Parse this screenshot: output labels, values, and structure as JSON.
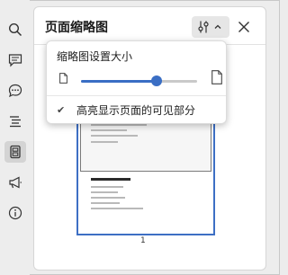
{
  "sidebar": {
    "items": [
      {
        "icon": "search-icon",
        "active": false
      },
      {
        "icon": "comment-icon",
        "active": false
      },
      {
        "icon": "chat-bubbles-icon",
        "active": false
      },
      {
        "icon": "outline-list-icon",
        "active": false
      },
      {
        "icon": "thumbnails-icon",
        "active": true
      },
      {
        "icon": "megaphone-icon",
        "active": false
      },
      {
        "icon": "info-icon",
        "active": false
      }
    ]
  },
  "panel": {
    "title": "页面缩略图",
    "options_icon": "sliders-icon",
    "options_chevron": "chevron-up-icon",
    "close_icon": "close-icon"
  },
  "popup": {
    "title": "缩略图设置大小",
    "slider_value": 0.65,
    "small_icon": "page-small-icon",
    "large_icon": "page-large-icon",
    "checkbox_label": "高亮显示页面的可见部分",
    "checkbox_checked": true,
    "check_glyph": "✔"
  },
  "thumbnail": {
    "page_number": "1"
  },
  "colors": {
    "accent": "#3a6ec4",
    "panel_bg": "#ffffff",
    "sidebar_bg": "#ededed"
  }
}
